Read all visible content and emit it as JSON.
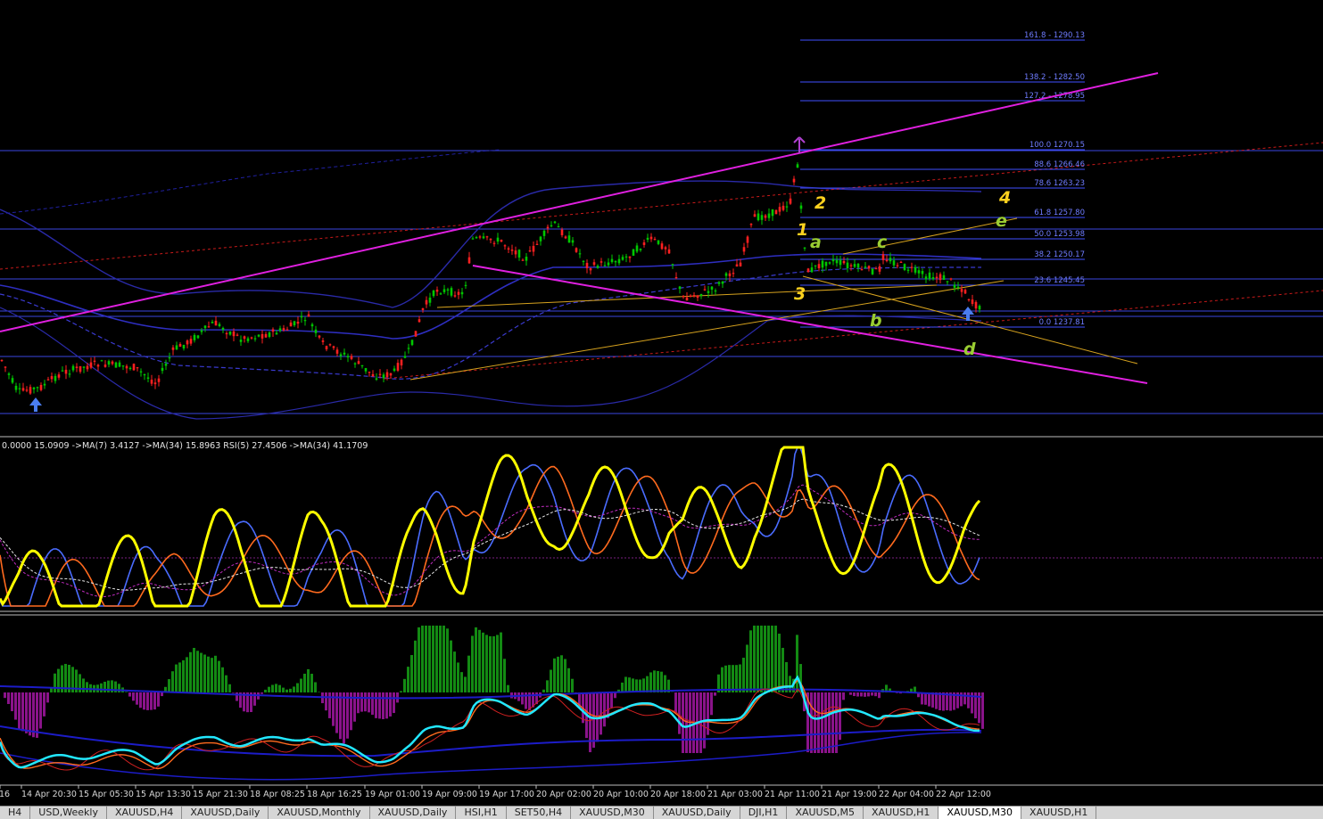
{
  "indicator_legend": "0.0000 15.0909  ->MA(7) 3.4127  ->MA(34) 15.8963  RSI(5) 27.4506  ->MA(34) 41.1709",
  "fib_levels": [
    {
      "label": "161.8 - 1290.13"
    },
    {
      "label": "138.2 - 1282.50"
    },
    {
      "label": "127.2 - 1278.95"
    },
    {
      "label": "100.0 1270.15"
    },
    {
      "label": "88.6 1266.46"
    },
    {
      "label": "78.6 1263.23"
    },
    {
      "label": "61.8 1257.80"
    },
    {
      "label": "50.0 1253.98"
    },
    {
      "label": "38.2 1250.17"
    },
    {
      "label": "23.6 1245.45"
    },
    {
      "label": "0.0 1237.81"
    }
  ],
  "wave_labels": [
    {
      "text": "1",
      "color": "#ffd21e"
    },
    {
      "text": "2",
      "color": "#ffd21e"
    },
    {
      "text": "3",
      "color": "#ffd21e"
    },
    {
      "text": "4",
      "color": "#ffd21e"
    },
    {
      "text": "a",
      "color": "#9acd32"
    },
    {
      "text": "b",
      "color": "#9acd32"
    },
    {
      "text": "c",
      "color": "#9acd32"
    },
    {
      "text": "d",
      "color": "#9acd32"
    },
    {
      "text": "e",
      "color": "#9acd32"
    }
  ],
  "time_axis": [
    "16",
    "14 Apr 20:30",
    "15 Apr 05:30",
    "15 Apr 13:30",
    "15 Apr 21:30",
    "18 Apr 08:25",
    "18 Apr 16:25",
    "19 Apr 01:00",
    "19 Apr 09:00",
    "19 Apr 17:00",
    "20 Apr 02:00",
    "20 Apr 10:00",
    "20 Apr 18:00",
    "21 Apr 03:00",
    "21 Apr 11:00",
    "21 Apr 19:00",
    "22 Apr 04:00",
    "22 Apr 12:00"
  ],
  "tabs": [
    "H4",
    "USD,Weekly",
    "XAUUSD,H4",
    "XAUUSD,Daily",
    "XAUUSD,Monthly",
    "XAUUSD,Daily",
    "HSI,H1",
    "SET50,H4",
    "XAUUSD,M30",
    "XAUUSD,Daily",
    "DJI,H1",
    "XAUUSD,M5",
    "XAUUSD,H1",
    "XAUUSD,M30",
    "XAUUSD,H1"
  ],
  "active_tab": 13,
  "colors": {
    "background": "#000000",
    "candle_up": "#00c800",
    "candle_down": "#ff2020",
    "channel": "#e020e0",
    "fib": "#4050ff",
    "hist_up": "#138a13",
    "hist_down": "#8a138a",
    "rsi_line": "#ffff00",
    "cyan_line": "#22e8ff"
  }
}
